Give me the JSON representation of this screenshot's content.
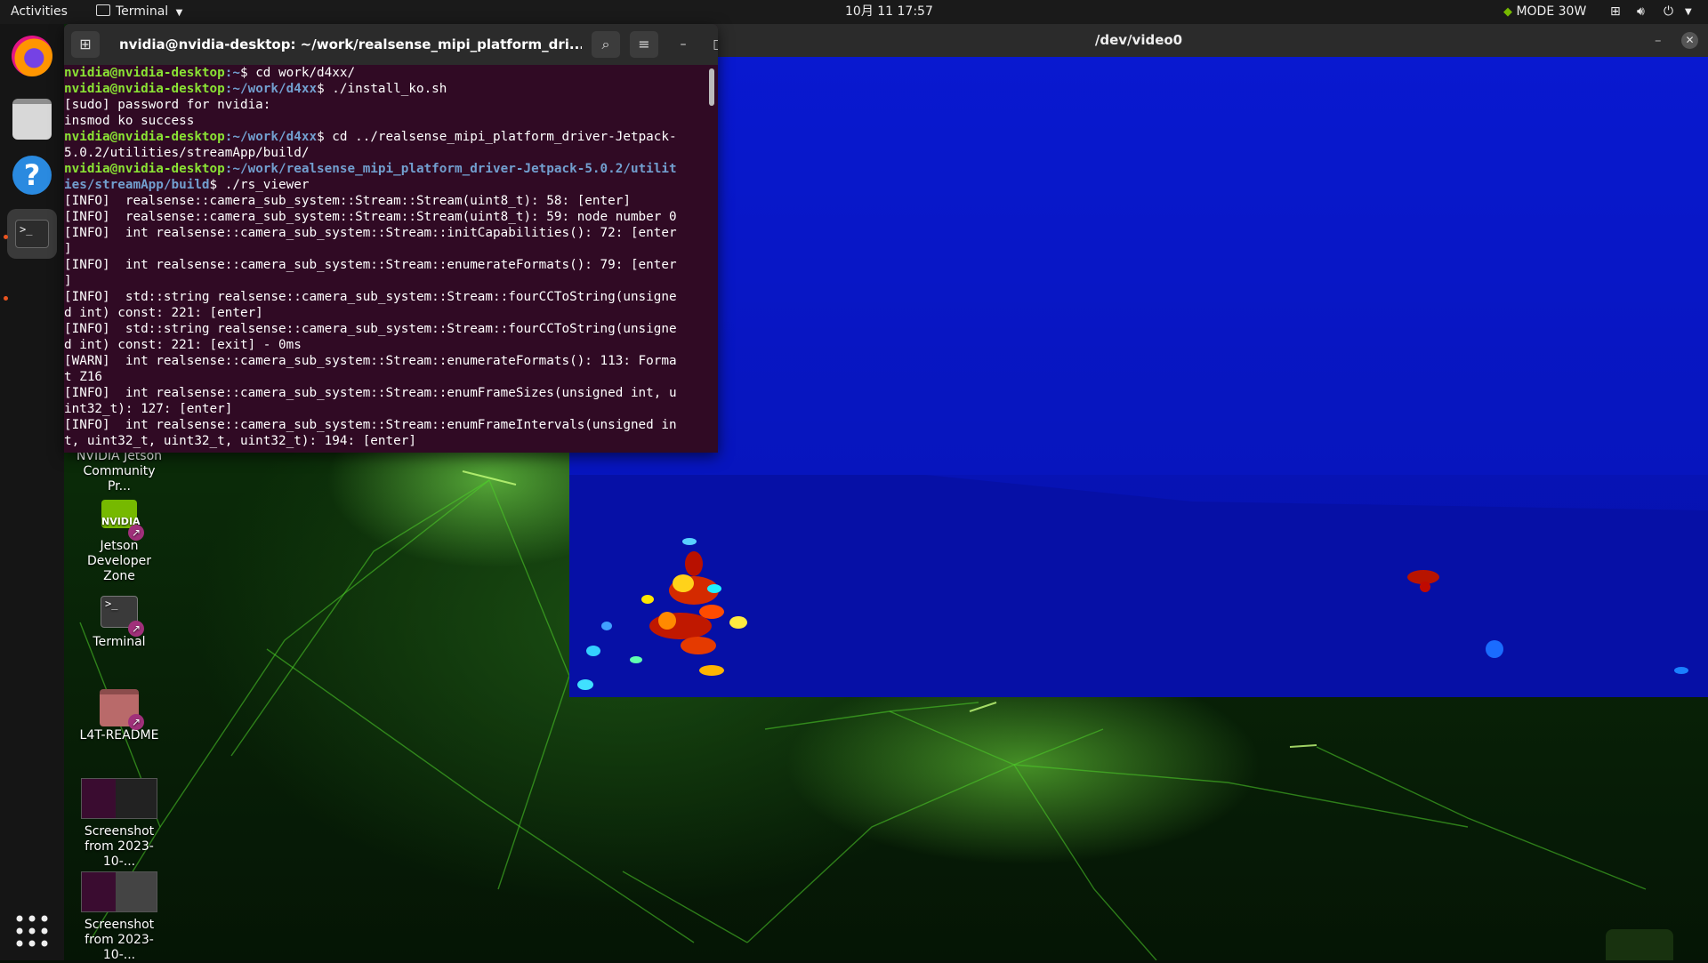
{
  "topbar": {
    "activities": "Activities",
    "app_menu": "Terminal",
    "clock": "10月 11  17:57",
    "power_mode": "MODE 30W"
  },
  "dock": {
    "apps": [
      "Firefox",
      "Files",
      "Help",
      "Terminal"
    ],
    "show_apps": "Show Applications"
  },
  "desktop": {
    "icons": [
      {
        "label": "NVIDIA Jetson Community Pr..."
      },
      {
        "label": "Jetson Developer Zone"
      },
      {
        "label": "Terminal"
      },
      {
        "label": "L4T-README"
      },
      {
        "label": "Screenshot from 2023-10-..."
      },
      {
        "label": "Screenshot from 2023-10-..."
      }
    ]
  },
  "video_window": {
    "title": "/dev/video0"
  },
  "terminal": {
    "title": "nvidia@nvidia-desktop: ~/work/realsense_mipi_platform_dri...",
    "lines": [
      {
        "user": "nvidia@nvidia-desktop",
        "path": ":~",
        "text": "$ cd work/d4xx/"
      },
      {
        "user": "nvidia@nvidia-desktop",
        "path": ":~/work/d4xx",
        "text": "$ ./install_ko.sh"
      },
      {
        "user": "",
        "path": "",
        "text": "[sudo] password for nvidia:"
      },
      {
        "user": "",
        "path": "",
        "text": "insmod ko success"
      },
      {
        "user": "nvidia@nvidia-desktop",
        "path": ":~/work/d4xx",
        "text": "$ cd ../realsense_mipi_platform_driver-Jetpack-"
      },
      {
        "user": "",
        "path": "",
        "text": "5.0.2/utilities/streamApp/build/"
      },
      {
        "user": "nvidia@nvidia-desktop",
        "path": ":~/work/realsense_mipi_platform_driver-Jetpack-5.0.2/utilit",
        "text": ""
      },
      {
        "user": "",
        "path": "ies/streamApp/build",
        "text": "$ ./rs_viewer"
      },
      {
        "user": "",
        "path": "",
        "text": "[INFO]  realsense::camera_sub_system::Stream::Stream(uint8_t): 58: [enter]"
      },
      {
        "user": "",
        "path": "",
        "text": "[INFO]  realsense::camera_sub_system::Stream::Stream(uint8_t): 59: node number 0"
      },
      {
        "user": "",
        "path": "",
        "text": "[INFO]  int realsense::camera_sub_system::Stream::initCapabilities(): 72: [enter"
      },
      {
        "user": "",
        "path": "",
        "text": "]"
      },
      {
        "user": "",
        "path": "",
        "text": "[INFO]  int realsense::camera_sub_system::Stream::enumerateFormats(): 79: [enter"
      },
      {
        "user": "",
        "path": "",
        "text": "]"
      },
      {
        "user": "",
        "path": "",
        "text": "[INFO]  std::string realsense::camera_sub_system::Stream::fourCCToString(unsigne"
      },
      {
        "user": "",
        "path": "",
        "text": "d int) const: 221: [enter]"
      },
      {
        "user": "",
        "path": "",
        "text": "[INFO]  std::string realsense::camera_sub_system::Stream::fourCCToString(unsigne"
      },
      {
        "user": "",
        "path": "",
        "text": "d int) const: 221: [exit] - 0ms"
      },
      {
        "user": "",
        "path": "",
        "text": "[WARN]  int realsense::camera_sub_system::Stream::enumerateFormats(): 113: Forma"
      },
      {
        "user": "",
        "path": "",
        "text": "t Z16"
      },
      {
        "user": "",
        "path": "",
        "text": "[INFO]  int realsense::camera_sub_system::Stream::enumFrameSizes(unsigned int, u"
      },
      {
        "user": "",
        "path": "",
        "text": "int32_t): 127: [enter]"
      },
      {
        "user": "",
        "path": "",
        "text": "[INFO]  int realsense::camera_sub_system::Stream::enumFrameIntervals(unsigned in"
      },
      {
        "user": "",
        "path": "",
        "text": "t, uint32_t, uint32_t, uint32_t): 194: [enter]"
      }
    ]
  },
  "colors": {
    "terminal_bg": "#300a24",
    "prompt_user": "#8ae234",
    "prompt_path": "#729fcf",
    "close_button": "#e95420"
  }
}
